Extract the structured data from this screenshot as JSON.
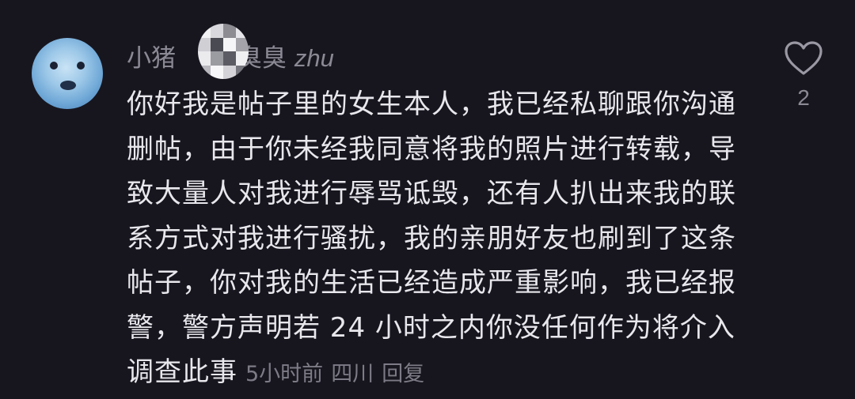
{
  "comment": {
    "username_prefix": "小猪",
    "username_suffix": "臭臭",
    "username_latin": "zhu",
    "lines": [
      "你好我是帖子里的女生本人，我已经私聊跟你沟通",
      "删帖，由于你未经我同意将我的照片进行转载，导",
      "致大量人对我进行辱骂诋毁，还有人扒出来我的联",
      "系方式对我进行骚扰，我的亲朋好友也刷到了这条",
      "帖子，你对我的生活已经造成严重影响，我已经报",
      "警，警方声明若 24 小时之内你没任何作为将介入",
      "调查此事"
    ],
    "time_ago": "5小时前",
    "location": "四川",
    "reply_label": "回复",
    "like_count": "2"
  },
  "colors": {
    "background": "#17161f",
    "text": "#e8e7ec",
    "muted": "#8b8a94"
  },
  "icons": {
    "like": "heart-outline-icon",
    "avatar": "seal-avatar"
  }
}
